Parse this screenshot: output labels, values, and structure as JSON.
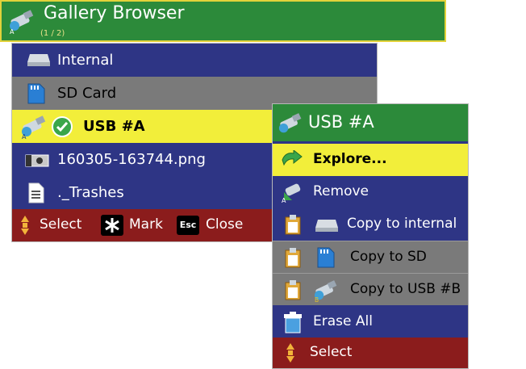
{
  "window": {
    "title": "Gallery Browser",
    "subtitle": "(1 / 2)",
    "icon": "usb-drive-icon"
  },
  "browser": {
    "items": [
      {
        "label": "Internal",
        "icon": "internal-drive-icon",
        "state": "normal"
      },
      {
        "label": "SD Card",
        "icon": "sd-card-icon",
        "state": "highlighted"
      },
      {
        "label": "USB #A",
        "icon": "usb-drive-icon",
        "state": "selected",
        "check_icon": "check-circle-icon"
      },
      {
        "label": "160305-163744.png",
        "icon": "camera-image-icon",
        "state": "normal"
      },
      {
        "label": "._Trashes",
        "icon": "document-icon",
        "state": "normal"
      }
    ],
    "status": {
      "select": "Select",
      "mark": "Mark",
      "esc_key": "Esc",
      "close": "Close"
    }
  },
  "popup": {
    "title": "USB #A",
    "items": [
      {
        "label": "Explore...",
        "icon": "explore-arrow-icon",
        "state": "selected"
      },
      {
        "label": "Remove",
        "icon": "remove-usb-icon",
        "state": "normal"
      },
      {
        "label": "Copy to internal",
        "icon": "clipboard-icon",
        "state": "normal"
      },
      {
        "label": "Copy to SD",
        "icon": "clipboard-icon",
        "state": "highlighted"
      },
      {
        "label": "Copy to USB #B",
        "icon": "clipboard-icon",
        "state": "highlighted"
      },
      {
        "label": "Erase All",
        "icon": "trash-icon",
        "state": "normal"
      }
    ],
    "status": {
      "select": "Select"
    }
  },
  "colors": {
    "panel": "#2e3585",
    "title_green": "#2c8a3a",
    "selected_yellow": "#f2ee3a",
    "highlight_grey": "#7a7a7a",
    "status_red": "#8b1c1c"
  }
}
